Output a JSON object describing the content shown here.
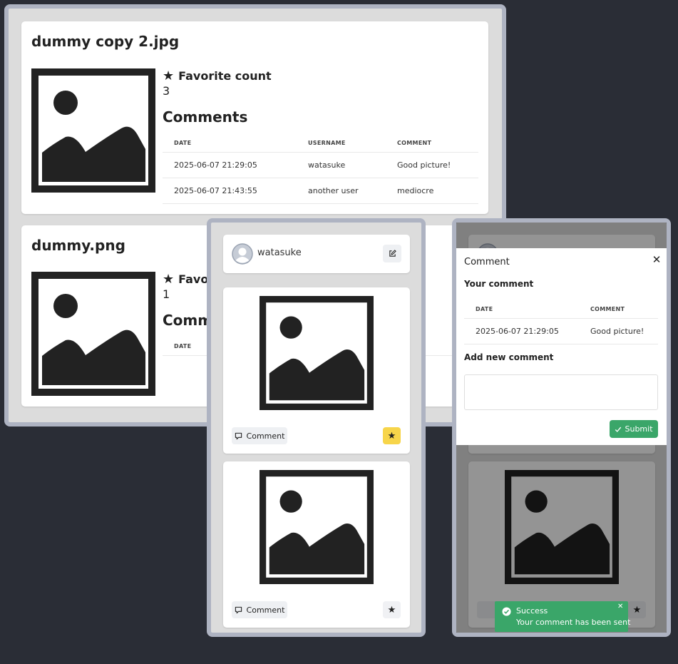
{
  "colors": {
    "background": "#2a2d36",
    "frame": "#aeb3c2",
    "success": "#3aa669",
    "favorite_active": "#f7d54a"
  },
  "detail": {
    "images": [
      {
        "filename": "dummy copy 2.jpg",
        "favorite_label": "Favorite count",
        "favorite_count": "3",
        "comments_heading": "Comments",
        "columns": [
          "DATE",
          "USERNAME",
          "COMMENT"
        ],
        "rows": [
          {
            "date": "2025-06-07 21:29:05",
            "username": "watasuke",
            "comment": "Good picture!"
          },
          {
            "date": "2025-06-07 21:43:55",
            "username": "another user",
            "comment": "mediocre"
          }
        ]
      },
      {
        "filename": "dummy.png",
        "favorite_label": "Favorite count",
        "favorite_count": "1",
        "comments_heading": "Comments",
        "columns": [
          "DATE"
        ]
      }
    ]
  },
  "mobile": {
    "username": "watasuke",
    "comment_button": "Comment",
    "posts": [
      {
        "favorited": true
      },
      {
        "favorited": false
      }
    ]
  },
  "modal": {
    "title": "Comment",
    "your_comment_heading": "Your comment",
    "columns": [
      "DATE",
      "COMMENT"
    ],
    "rows": [
      {
        "date": "2025-06-07 21:29:05",
        "comment": "Good picture!"
      }
    ],
    "add_heading": "Add new comment",
    "textarea_value": "",
    "submit_label": "Submit"
  },
  "toast": {
    "title": "Success",
    "message": "Your comment has been sent"
  }
}
